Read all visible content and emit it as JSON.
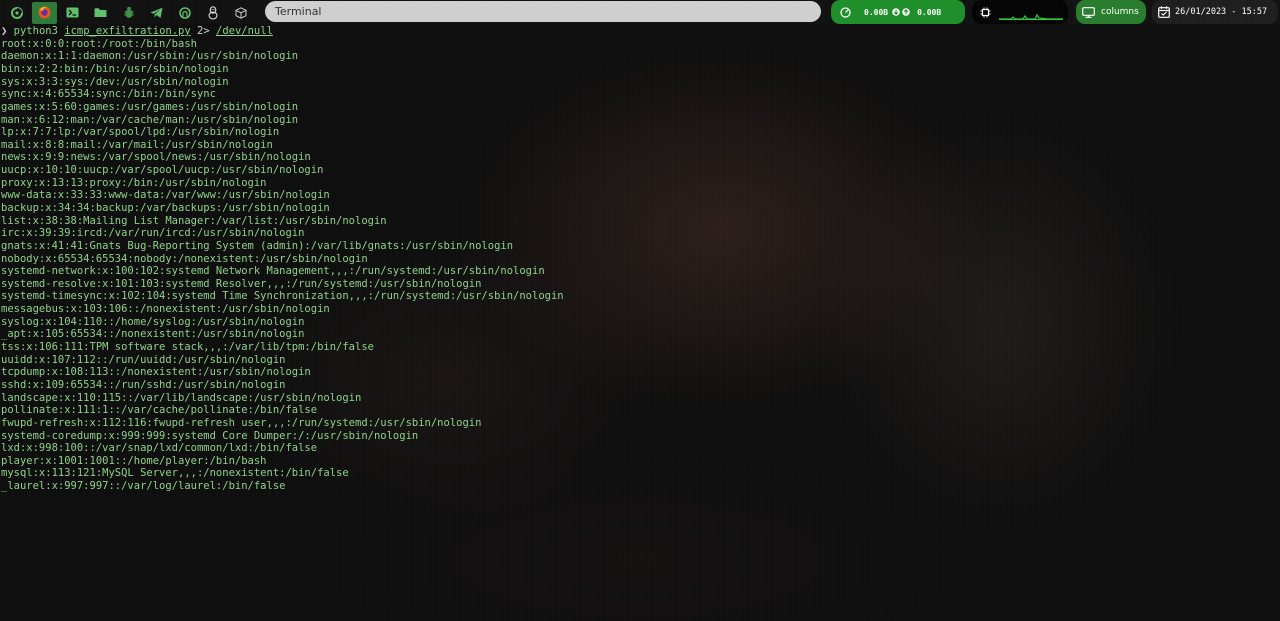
{
  "topbar": {
    "launchers": [
      {
        "icon": "distro-swirl-icon"
      },
      {
        "icon": "firefox-icon",
        "active": true
      },
      {
        "icon": "terminal-icon"
      },
      {
        "icon": "folder-icon"
      },
      {
        "icon": "bug-icon"
      },
      {
        "icon": "telegram-icon"
      },
      {
        "icon": "github-icon"
      },
      {
        "icon": "linux-tux-icon"
      },
      {
        "icon": "cube-icon"
      }
    ],
    "window_title": "Terminal",
    "network": {
      "download": "0.00B",
      "upload": "0.00B"
    },
    "layout": {
      "label": "columns"
    },
    "clock": {
      "datetime": "26/01/2023 - 15:57"
    },
    "colors": {
      "accent_green": "#1e8f2a",
      "terminal_text": "#8fd28a"
    }
  },
  "terminal": {
    "prompt": {
      "symbol": "❯",
      "command": "python3",
      "script": "icmp_exfiltration.py",
      "redirect": "2>",
      "target": "/dev/null"
    },
    "output": [
      "root:x:0:0:root:/root:/bin/bash",
      "daemon:x:1:1:daemon:/usr/sbin:/usr/sbin/nologin",
      "bin:x:2:2:bin:/bin:/usr/sbin/nologin",
      "sys:x:3:3:sys:/dev:/usr/sbin/nologin",
      "sync:x:4:65534:sync:/bin:/bin/sync",
      "games:x:5:60:games:/usr/games:/usr/sbin/nologin",
      "man:x:6:12:man:/var/cache/man:/usr/sbin/nologin",
      "lp:x:7:7:lp:/var/spool/lpd:/usr/sbin/nologin",
      "mail:x:8:8:mail:/var/mail:/usr/sbin/nologin",
      "news:x:9:9:news:/var/spool/news:/usr/sbin/nologin",
      "uucp:x:10:10:uucp:/var/spool/uucp:/usr/sbin/nologin",
      "proxy:x:13:13:proxy:/bin:/usr/sbin/nologin",
      "www-data:x:33:33:www-data:/var/www:/usr/sbin/nologin",
      "backup:x:34:34:backup:/var/backups:/usr/sbin/nologin",
      "list:x:38:38:Mailing List Manager:/var/list:/usr/sbin/nologin",
      "irc:x:39:39:ircd:/var/run/ircd:/usr/sbin/nologin",
      "gnats:x:41:41:Gnats Bug-Reporting System (admin):/var/lib/gnats:/usr/sbin/nologin",
      "nobody:x:65534:65534:nobody:/nonexistent:/usr/sbin/nologin",
      "systemd-network:x:100:102:systemd Network Management,,,:/run/systemd:/usr/sbin/nologin",
      "systemd-resolve:x:101:103:systemd Resolver,,,:/run/systemd:/usr/sbin/nologin",
      "systemd-timesync:x:102:104:systemd Time Synchronization,,,:/run/systemd:/usr/sbin/nologin",
      "messagebus:x:103:106::/nonexistent:/usr/sbin/nologin",
      "syslog:x:104:110::/home/syslog:/usr/sbin/nologin",
      "_apt:x:105:65534::/nonexistent:/usr/sbin/nologin",
      "tss:x:106:111:TPM software stack,,,:/var/lib/tpm:/bin/false",
      "uuidd:x:107:112::/run/uuidd:/usr/sbin/nologin",
      "tcpdump:x:108:113::/nonexistent:/usr/sbin/nologin",
      "sshd:x:109:65534::/run/sshd:/usr/sbin/nologin",
      "landscape:x:110:115::/var/lib/landscape:/usr/sbin/nologin",
      "pollinate:x:111:1::/var/cache/pollinate:/bin/false",
      "fwupd-refresh:x:112:116:fwupd-refresh user,,,:/run/systemd:/usr/sbin/nologin",
      "systemd-coredump:x:999:999:systemd Core Dumper:/:/usr/sbin/nologin",
      "lxd:x:998:100::/var/snap/lxd/common/lxd:/bin/false",
      "player:x:1001:1001::/home/player:/bin/bash",
      "mysql:x:113:121:MySQL Server,,,:/nonexistent:/bin/false",
      "_laurel:x:997:997::/var/log/laurel:/bin/false"
    ]
  }
}
